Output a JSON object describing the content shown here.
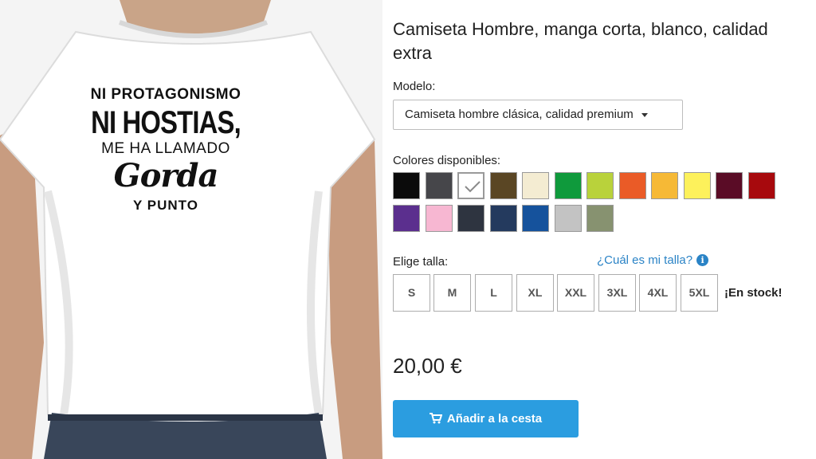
{
  "product_image": {
    "print_lines": [
      "NI PROTAGONISMO",
      "NI HOSTIAS,",
      "ME HA LLAMADO",
      "Gorda",
      "Y PUNTO"
    ]
  },
  "product": {
    "title": "Camiseta Hombre, manga corta, blanco, calidad extra",
    "model_label": "Modelo:",
    "model_selected": "Camiseta hombre clásica, calidad premium",
    "colors_label": "Colores disponibles:",
    "colors": [
      "#0b0b0b",
      "#46464a",
      "#ffffff",
      "#5a4624",
      "#f4ecd2",
      "#0f9a3c",
      "#b9d23b",
      "#ea5b27",
      "#f6b936",
      "#fdf15b",
      "#5a0c26",
      "#a7090d",
      "#5b2f8e",
      "#f7b7d2",
      "#2e3440",
      "#243a5e",
      "#15529c",
      "#c3c3c3",
      "#879270"
    ],
    "selected_color_index": 2,
    "size_label": "Elige talla:",
    "size_help": "¿Cuál es mi talla?",
    "sizes": [
      "S",
      "M",
      "L",
      "XL",
      "XXL",
      "3XL",
      "4XL",
      "5XL"
    ],
    "stock": "¡En stock!",
    "price": "20,00 €",
    "cart_button": "Añadir a la cesta"
  }
}
